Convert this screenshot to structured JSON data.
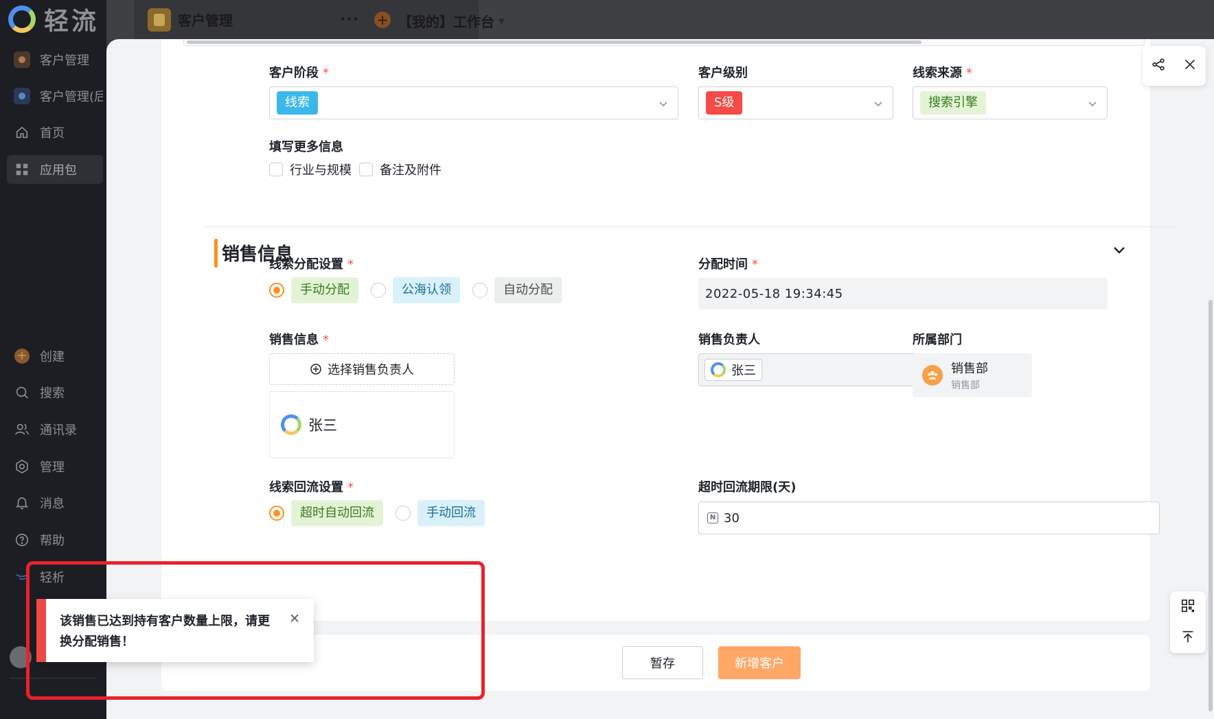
{
  "app": {
    "brand": "轻流"
  },
  "sidebar": {
    "items": [
      {
        "label": "客户管理",
        "icon": "app-icon-orange"
      },
      {
        "label": "客户管理(后",
        "icon": "app-icon-blue"
      },
      {
        "label": "首页",
        "icon": "home-icon"
      },
      {
        "label": "应用包",
        "icon": "apps-icon"
      },
      {
        "label": "创建",
        "icon": "plus-icon"
      },
      {
        "label": "搜索",
        "icon": "search-icon"
      },
      {
        "label": "通讯录",
        "icon": "contacts-icon"
      },
      {
        "label": "管理",
        "icon": "settings-icon"
      },
      {
        "label": "消息",
        "icon": "bell-icon"
      },
      {
        "label": "帮助",
        "icon": "help-icon"
      },
      {
        "label": "轻析",
        "icon": "analytics-icon"
      }
    ]
  },
  "topbar": {
    "app_tab": "客户管理",
    "more": "···",
    "workbench": "【我的】工作台"
  },
  "form": {
    "stage": {
      "label": "客户阶段",
      "required": "*",
      "value": "线索"
    },
    "level": {
      "label": "客户级别",
      "value": "S级"
    },
    "source": {
      "label": "线索来源",
      "required": "*",
      "value": "搜索引擎"
    },
    "more_info": {
      "label": "填写更多信息",
      "options": [
        "行业与规模",
        "备注及附件"
      ]
    },
    "section_title": "销售信息",
    "assign": {
      "label": "线索分配设置",
      "required": "*",
      "options": [
        "手动分配",
        "公海认领",
        "自动分配"
      ],
      "selected": "手动分配"
    },
    "assign_time": {
      "label": "分配时间",
      "required": "*",
      "value": "2022-05-18 19:34:45"
    },
    "sales": {
      "label": "销售信息",
      "required": "*",
      "pick_button": "选择销售负责人",
      "person": "张三"
    },
    "owner": {
      "label": "销售负责人",
      "value": "张三"
    },
    "department": {
      "label": "所属部门",
      "name": "销售部",
      "sub": "销售部"
    },
    "reflow": {
      "label": "线索回流设置",
      "required": "*",
      "options": [
        "超时自动回流",
        "手动回流"
      ],
      "selected": "超时自动回流"
    },
    "timeout": {
      "label": "超时回流期限(天)",
      "value": "30"
    }
  },
  "footer": {
    "save_label": "暂存",
    "submit_label": "新增客户"
  },
  "toast": {
    "message": "该销售已达到持有客户数量上限，请更换分配销售！"
  },
  "colors": {
    "accent": "#ff8f1f",
    "error": "#f04a45",
    "primary_button": "#ffa766",
    "highlight": "#e8222b"
  }
}
